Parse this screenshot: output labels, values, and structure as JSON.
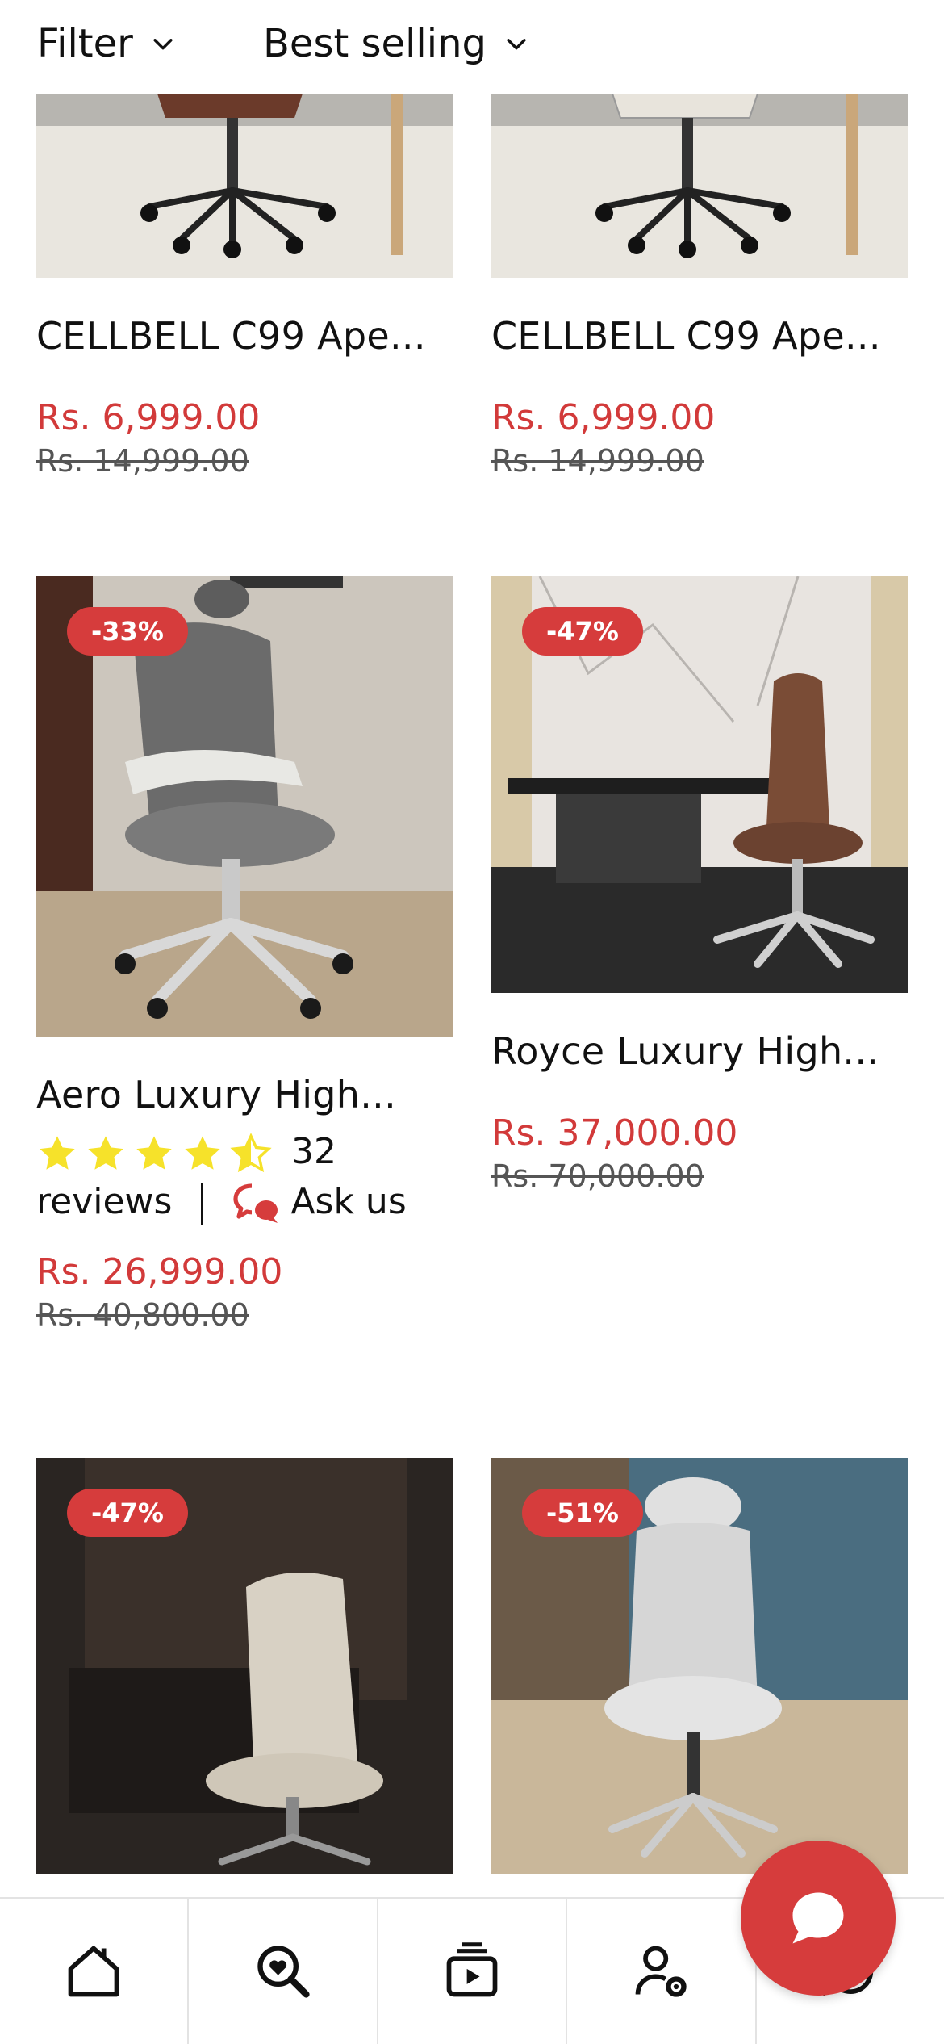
{
  "filter_bar": {
    "filter_label": "Filter",
    "sort_label": "Best selling"
  },
  "products": [
    {
      "title": "CELLBELL C99 Ape...",
      "price": "Rs. 6,999.00",
      "compare_price": "Rs. 14,999.00",
      "seat_color": "#6b3a2a"
    },
    {
      "title": "CELLBELL C99 Ape...",
      "price": "Rs. 6,999.00",
      "compare_price": "Rs. 14,999.00",
      "seat_color": "#e8e4dc"
    },
    {
      "badge": "-33%",
      "title": "Aero Luxury High...",
      "rating_value": 4.5,
      "review_count": "32",
      "reviews_label": "reviews",
      "ask_label": "Ask us",
      "price": "Rs. 26,999.00",
      "compare_price": "Rs. 40,800.00"
    },
    {
      "badge": "-47%",
      "title": "Royce Luxury High...",
      "price": "Rs. 37,000.00",
      "compare_price": "Rs. 70,000.00"
    },
    {
      "badge": "-47%"
    },
    {
      "badge": "-51%"
    }
  ],
  "bottom_nav": {
    "items": [
      "home-icon",
      "search-heart-icon",
      "video-icon",
      "account-settings-icon",
      "chat-icon"
    ]
  },
  "colors": {
    "accent": "#d63c3c",
    "price": "#d23a3a",
    "star": "#f6e22a"
  }
}
